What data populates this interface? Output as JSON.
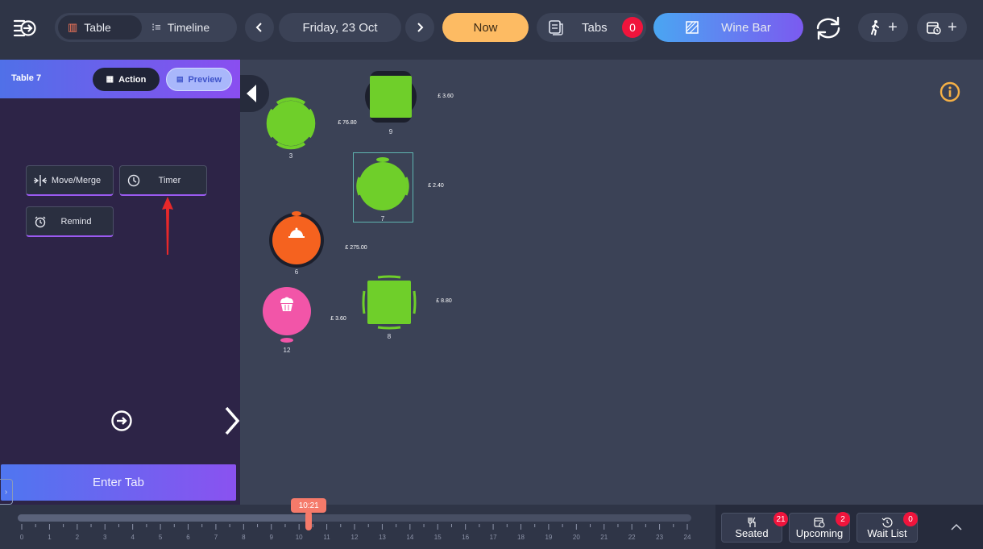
{
  "topbar": {
    "view_modes": [
      {
        "label": "Table",
        "icon": "table-icon",
        "active": true
      },
      {
        "label": "Timeline",
        "icon": "timeline-icon",
        "active": false
      }
    ],
    "date": "Friday, 23 Oct",
    "now_label": "Now",
    "tabs_label": "Tabs",
    "tabs_count": "0",
    "area_name": "Wine Bar",
    "icons": [
      "menu-icon",
      "chevron-left-icon",
      "chevron-right-icon",
      "receipt-icon",
      "floorplan-icon",
      "sync-icon",
      "walk-in-icon",
      "plus-icon",
      "reservation-icon"
    ]
  },
  "panel": {
    "title": "Table 7",
    "action_label": "Action",
    "preview_label": "Preview",
    "actions": [
      {
        "label": "Move/Merge",
        "icon": "move-merge-icon"
      },
      {
        "label": "Timer",
        "icon": "clock-icon"
      },
      {
        "label": "Remind",
        "icon": "alarm-icon"
      }
    ],
    "enter_tab_label": "Enter Tab"
  },
  "floor": {
    "tables": [
      {
        "number": "3",
        "amount": "£ 76.80",
        "shape": "round",
        "status": "seated",
        "color": "#6fcf2a"
      },
      {
        "number": "9",
        "amount": "£ 3.60",
        "shape": "square",
        "status": "seated",
        "color": "#6fcf2a"
      },
      {
        "number": "7",
        "amount": "£ 2.40",
        "shape": "round",
        "status": "selected",
        "color": "#6fcf2a"
      },
      {
        "number": "6",
        "amount": "£ 275.00",
        "shape": "round",
        "status": "served",
        "color": "#f5621f",
        "icon": "cloche-icon"
      },
      {
        "number": "8",
        "amount": "£ 8.80",
        "shape": "square",
        "status": "seated",
        "color": "#6fcf2a"
      },
      {
        "number": "12",
        "amount": "£ 3.60",
        "shape": "round",
        "status": "dessert",
        "color": "#f255a8",
        "icon": "cupcake-icon"
      }
    ]
  },
  "timeline": {
    "current_time": "10:21",
    "current_hour_value": 10.35,
    "hours": [
      "0",
      "1",
      "2",
      "3",
      "4",
      "5",
      "6",
      "7",
      "8",
      "9",
      "10",
      "11",
      "12",
      "13",
      "14",
      "15",
      "16",
      "17",
      "18",
      "19",
      "20",
      "21",
      "22",
      "23",
      "24"
    ]
  },
  "status": {
    "seated_label": "Seated",
    "seated_count": "21",
    "upcoming_label": "Upcoming",
    "upcoming_count": "2",
    "waitlist_label": "Wait List",
    "waitlist_count": "0"
  },
  "colors": {
    "accent_orange": "#fdbb63",
    "badge_red": "#f0143c",
    "table_green": "#6fcf2a",
    "table_orange": "#f5621f",
    "table_pink": "#f255a8",
    "annotation_red": "#e8282a"
  }
}
